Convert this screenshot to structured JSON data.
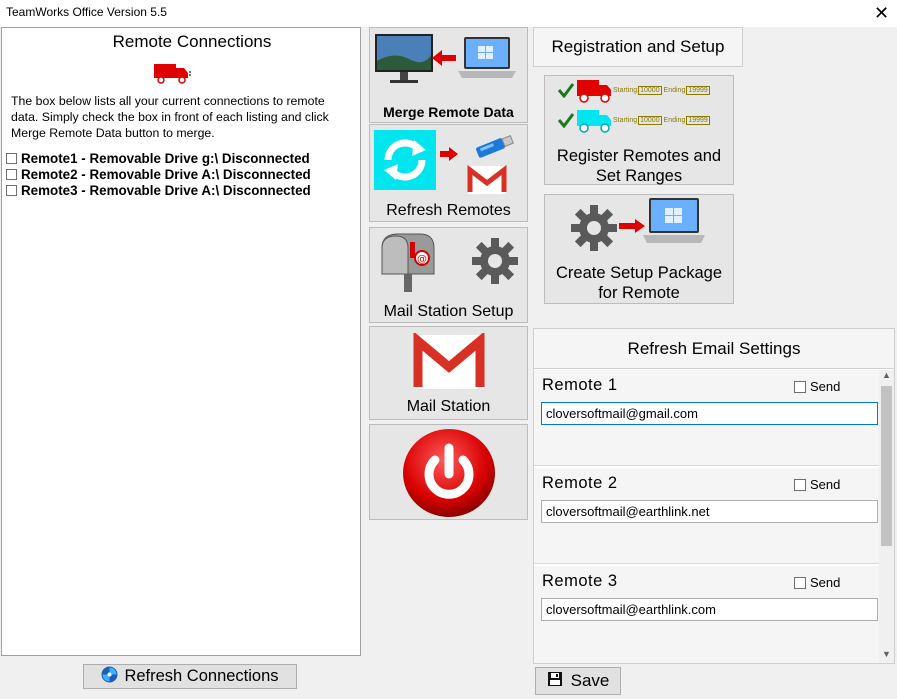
{
  "window": {
    "title": "TeamWorks Office Version 5.5",
    "close_glyph": "✕"
  },
  "left": {
    "heading": "Remote Connections",
    "intro": "The box below lists all your current connections to remote data. Simply check the box in front of each listing and click Merge Remote Data button to merge.",
    "connections": [
      "Remote1 - Removable Drive g:\\ Disconnected",
      "Remote2 - Removable Drive A:\\ Disconnected",
      "Remote3 - Removable Drive A:\\ Disconnected"
    ],
    "refresh_button": "Refresh Connections"
  },
  "tiles": {
    "merge": "Merge Remote Data",
    "refresh_remotes": "Refresh Remotes",
    "mail_setup": "Mail Station Setup",
    "mail_station": "Mail Station"
  },
  "registration": {
    "heading": "Registration and Setup",
    "register_label_1": "Register Remotes and",
    "register_label_2": "Set Ranges",
    "range_start_label": "Starting",
    "range_start_value": "10000",
    "range_end_label": "Ending",
    "range_end_value": "19999",
    "package_label_1": "Create Setup Package",
    "package_label_2": "for Remote"
  },
  "email": {
    "heading": "Refresh Email Settings",
    "send_label": "Send",
    "remotes": [
      {
        "name": "Remote  1",
        "email": "cloversoftmail@gmail.com"
      },
      {
        "name": "Remote  2",
        "email": "cloversoftmail@earthlink.net"
      },
      {
        "name": "Remote  3",
        "email": "cloversoftmail@earthlink.com"
      }
    ]
  },
  "save_button": "Save",
  "colors": {
    "accent_red": "#e00000",
    "accent_cyan": "#00e5ee",
    "check_green": "#1a7a1a",
    "focus_blue": "#0078d7"
  }
}
